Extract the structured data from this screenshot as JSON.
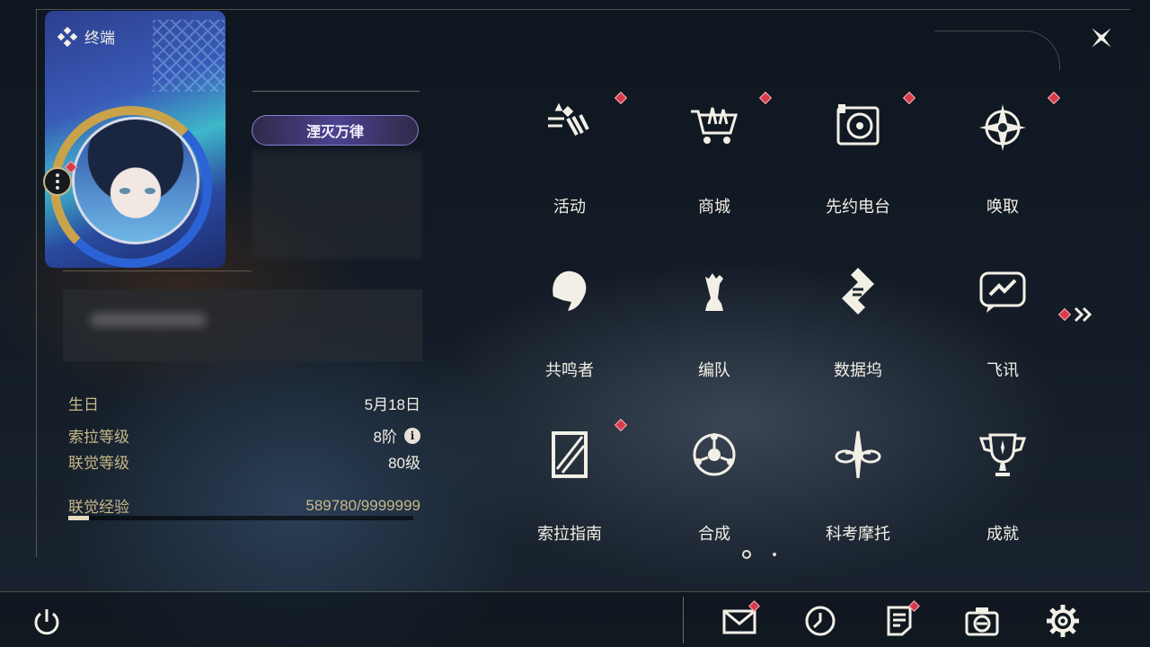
{
  "header": {
    "title": "终端"
  },
  "profile": {
    "title_badge": "湮灭万律",
    "stats": [
      {
        "label": "生日",
        "value": "5月18日"
      },
      {
        "label": "索拉等级",
        "value": "8阶",
        "info_glyph": "i"
      },
      {
        "label": "联觉等级",
        "value": "80级"
      },
      {
        "label": "联觉经验",
        "value": "589780/9999999"
      }
    ],
    "exp_progress": 0.059
  },
  "menu": [
    {
      "label": "活动",
      "icon": "activity-icon",
      "badge": true
    },
    {
      "label": "商城",
      "icon": "shop-cart-icon",
      "badge": true
    },
    {
      "label": "先约电台",
      "icon": "radio-icon",
      "badge": true
    },
    {
      "label": "唤取",
      "icon": "compass-star-icon",
      "badge": true
    },
    {
      "label": "共鸣者",
      "icon": "resonator-icon",
      "badge": false
    },
    {
      "label": "编队",
      "icon": "chess-icon",
      "badge": false
    },
    {
      "label": "数据坞",
      "icon": "data-bank-icon",
      "badge": false
    },
    {
      "label": "飞讯",
      "icon": "message-icon",
      "badge": false
    },
    {
      "label": "索拉指南",
      "icon": "guide-icon",
      "badge": true
    },
    {
      "label": "合成",
      "icon": "synthesis-icon",
      "badge": false
    },
    {
      "label": "科考摩托",
      "icon": "motorbike-icon",
      "badge": false
    },
    {
      "label": "成就",
      "icon": "trophy-icon",
      "badge": false
    }
  ],
  "pager": {
    "current": 1,
    "total": 2
  },
  "colors": {
    "accent_gold": "#c9a24a",
    "badge_red": "#d93a4a",
    "text": "#f2efe6"
  },
  "bottom_bar": [
    {
      "name": "mail",
      "icon": "mail-icon",
      "badge": true
    },
    {
      "name": "clock",
      "icon": "clock-icon",
      "badge": false
    },
    {
      "name": "notes",
      "icon": "notes-icon",
      "badge": true
    },
    {
      "name": "camera",
      "icon": "camera-icon",
      "badge": false
    },
    {
      "name": "settings",
      "icon": "gear-icon",
      "badge": false
    }
  ]
}
